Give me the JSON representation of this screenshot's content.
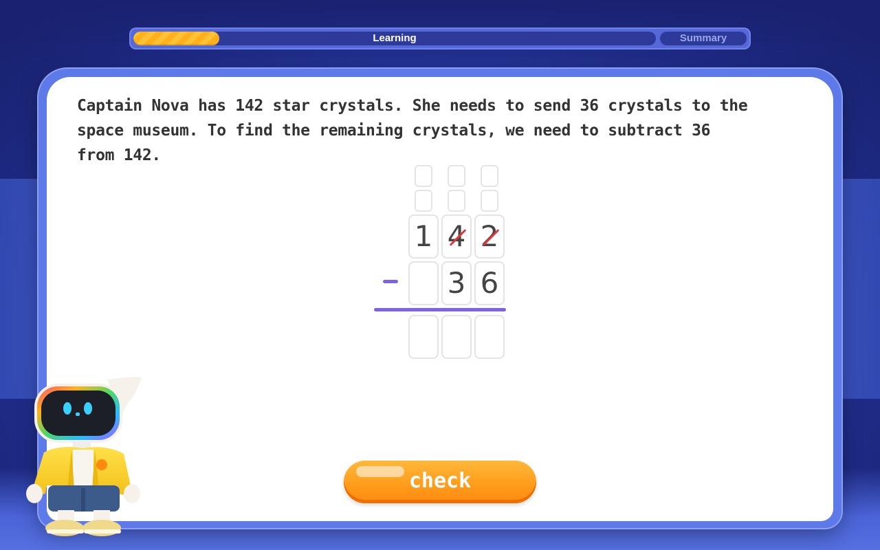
{
  "progress": {
    "label": "Learning",
    "fill_fraction": 0.165,
    "summary_label": "Summary"
  },
  "question": {
    "text": "Captain Nova has 142 star crystals. She needs to send 36 crystals to the space museum. To find the remaining crystals, we need to subtract 36 from 142."
  },
  "problem": {
    "operator": "-",
    "top_digits": [
      "1",
      "4",
      "2"
    ],
    "crossed_out": [
      false,
      true,
      true
    ],
    "bottom_digits": [
      "",
      "3",
      "6"
    ],
    "answer_digits": [
      "",
      "",
      ""
    ]
  },
  "check_button": {
    "label": "check"
  },
  "colors": {
    "accent_purple": "#7d62e8",
    "strike_red": "#e0383a",
    "button_orange": "#ff9d1c",
    "progress_yellow": "#ffc233"
  },
  "mascot": {
    "icon": "robot-mascot-icon"
  }
}
